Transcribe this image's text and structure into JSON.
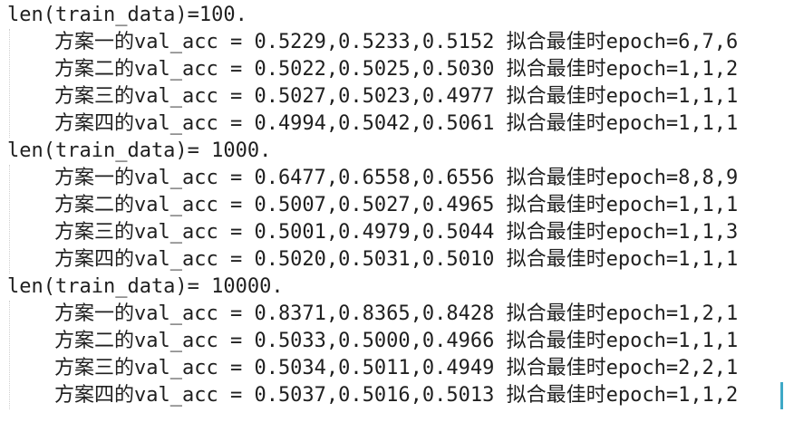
{
  "editor": {
    "blocks": [
      {
        "header": "len(train_data)=100.",
        "rows": [
          "方案一的val_acc = 0.5229,0.5233,0.5152 拟合最佳时epoch=6,7,6",
          "方案二的val_acc = 0.5022,0.5025,0.5030 拟合最佳时epoch=1,1,2",
          "方案三的val_acc = 0.5027,0.5023,0.4977 拟合最佳时epoch=1,1,1",
          "方案四的val_acc = 0.4994,0.5042,0.5061 拟合最佳时epoch=1,1,1"
        ]
      },
      {
        "header": "len(train_data)= 1000.",
        "rows": [
          "方案一的val_acc = 0.6477,0.6558,0.6556 拟合最佳时epoch=8,8,9",
          "方案二的val_acc = 0.5007,0.5027,0.4965 拟合最佳时epoch=1,1,1",
          "方案三的val_acc = 0.5001,0.4979,0.5044 拟合最佳时epoch=1,1,3",
          "方案四的val_acc = 0.5020,0.5031,0.5010 拟合最佳时epoch=1,1,1"
        ]
      },
      {
        "header": "len(train_data)= 10000.",
        "rows": [
          "方案一的val_acc = 0.8371,0.8365,0.8428 拟合最佳时epoch=1,2,1",
          "方案二的val_acc = 0.5033,0.5000,0.4966 拟合最佳时epoch=1,1,1",
          "方案三的val_acc = 0.5034,0.5011,0.4949 拟合最佳时epoch=2,2,1",
          "方案四的val_acc = 0.5037,0.5016,0.5013 拟合最佳时epoch=1,1,2"
        ]
      }
    ],
    "cursor_color": "#3fa9c7",
    "indent_guide_color": "#cfcfcf"
  }
}
